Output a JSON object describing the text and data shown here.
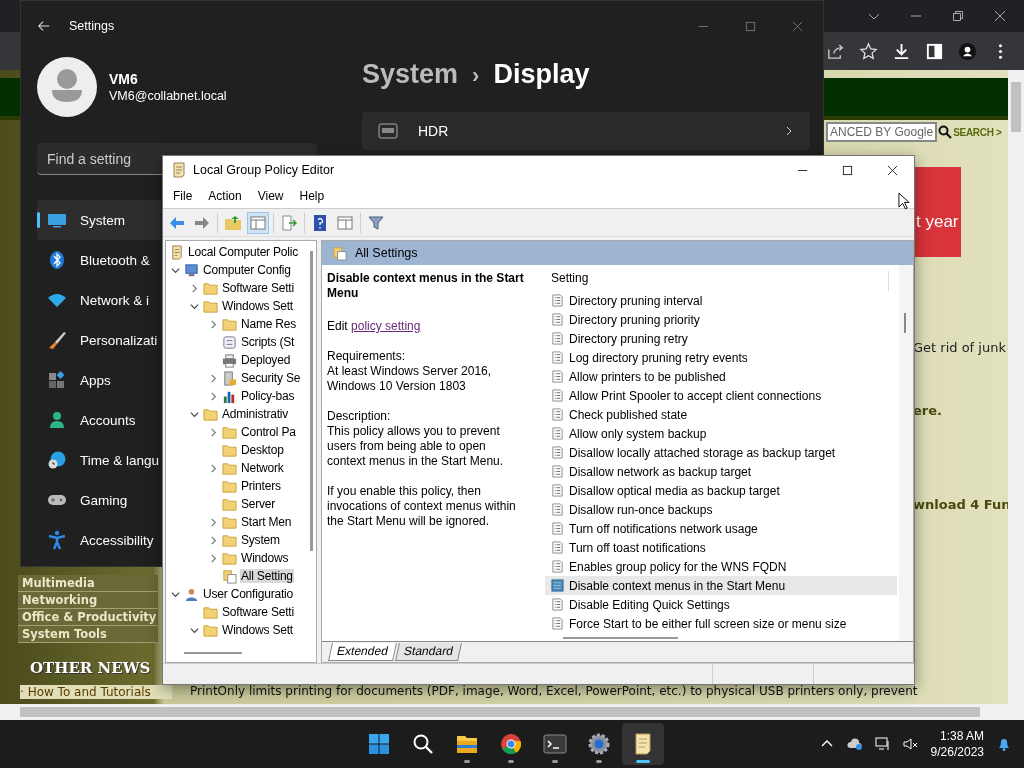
{
  "browser": {
    "search_box": "ANCED BY Google",
    "search_button": "SEARCH >",
    "ad_text": "t year",
    "snippets": [
      {
        "text": "Get rid of junk",
        "bold": false
      },
      {
        "text": "ere.",
        "bold": true
      },
      {
        "text": "wnload 4 Fun",
        "bold": true
      }
    ],
    "menu": [
      "Multimedia",
      "Networking",
      "Office & Productivity",
      "System Tools"
    ],
    "news_heading": "OTHER NEWS",
    "news_link": "· How To and Tutorials",
    "ticker": "PrintOnly limits printing for documents (PDF, image, Word, Excel, PowerPoint, etc.) to physical USB printers only, prevent"
  },
  "settings": {
    "title": "Settings",
    "user_name": "VM6",
    "user_email": "VM6@collabnet.local",
    "search": {
      "placeholder": "Find a setting"
    },
    "nav": [
      {
        "kind": "system",
        "label": "System",
        "selected": true
      },
      {
        "kind": "bluetooth",
        "label": "Bluetooth &",
        "selected": false
      },
      {
        "kind": "network",
        "label": "Network & i",
        "selected": false
      },
      {
        "kind": "personalization",
        "label": "Personalizati",
        "selected": false
      },
      {
        "kind": "apps",
        "label": "Apps",
        "selected": false
      },
      {
        "kind": "accounts",
        "label": "Accounts",
        "selected": false
      },
      {
        "kind": "time",
        "label": "Time & langu",
        "selected": false
      },
      {
        "kind": "gaming",
        "label": "Gaming",
        "selected": false
      },
      {
        "kind": "accessibility",
        "label": "Accessibility",
        "selected": false
      }
    ],
    "breadcrumb": [
      "System",
      "Display"
    ],
    "breadcrumb_separator": "›",
    "cards": [
      {
        "kind": "hdr",
        "label": "HDR"
      }
    ]
  },
  "gpo": {
    "title": "Local Group Policy Editor",
    "menu": [
      "File",
      "Action",
      "View",
      "Help"
    ],
    "tree": [
      {
        "kind": "scroll",
        "label": "Local Computer Polic",
        "selected": false,
        "children": [
          {
            "kind": "computer",
            "label": "Computer Config",
            "expanded": true,
            "selected": false,
            "children": [
              {
                "kind": "folder",
                "label": "Software Setti",
                "expanded": false,
                "selected": false
              },
              {
                "kind": "folder",
                "label": "Windows Sett",
                "expanded": true,
                "selected": false,
                "children": [
                  {
                    "kind": "folder",
                    "label": "Name Res",
                    "expanded": false,
                    "selected": false
                  },
                  {
                    "kind": "scripts",
                    "label": "Scripts (St",
                    "selected": false
                  },
                  {
                    "kind": "printer",
                    "label": "Deployed",
                    "selected": false
                  },
                  {
                    "kind": "security",
                    "label": "Security Se",
                    "expanded": false,
                    "selected": false
                  },
                  {
                    "kind": "chart",
                    "label": "Policy-bas",
                    "expanded": false,
                    "selected": false
                  }
                ]
              },
              {
                "kind": "folder",
                "label": "Administrativ",
                "expanded": true,
                "selected": false,
                "children": [
                  {
                    "kind": "folder",
                    "label": "Control Pa",
                    "expanded": false,
                    "selected": false
                  },
                  {
                    "kind": "folder",
                    "label": "Desktop",
                    "selected": false
                  },
                  {
                    "kind": "folder",
                    "label": "Network",
                    "expanded": false,
                    "selected": false
                  },
                  {
                    "kind": "folder",
                    "label": "Printers",
                    "selected": false
                  },
                  {
                    "kind": "folder",
                    "label": "Server",
                    "selected": false
                  },
                  {
                    "kind": "folder",
                    "label": "Start Men",
                    "expanded": false,
                    "selected": false
                  },
                  {
                    "kind": "folder",
                    "label": "System",
                    "expanded": false,
                    "selected": false
                  },
                  {
                    "kind": "folder",
                    "label": "Windows",
                    "expanded": false,
                    "selected": false
                  },
                  {
                    "kind": "allsettings",
                    "label": "All Setting",
                    "selected": true
                  }
                ]
              }
            ]
          },
          {
            "kind": "user",
            "label": "User Configuratio",
            "expanded": true,
            "selected": false,
            "children": [
              {
                "kind": "folder",
                "label": "Software Setti",
                "selected": false
              },
              {
                "kind": "folder",
                "label": "Windows Sett",
                "expanded": true,
                "selected": false
              }
            ]
          }
        ]
      }
    ],
    "header": "All Settings",
    "detail": {
      "title": "Disable context menus in the Start Menu",
      "edit_prefix": "Edit",
      "edit_link": "policy setting",
      "requirements_label": "Requirements:",
      "requirements": "At least Windows Server 2016, Windows 10 Version 1803",
      "description_label": "Description:",
      "paragraphs": [
        "This policy allows you to prevent users from being able to open context menus in the Start Menu.",
        "If you enable this policy, then invocations of context menus within the Start Menu will be ignored."
      ]
    },
    "column": "Setting",
    "policies": [
      {
        "label": "Directory pruning interval",
        "selected": false
      },
      {
        "label": "Directory pruning priority",
        "selected": false
      },
      {
        "label": "Directory pruning retry",
        "selected": false
      },
      {
        "label": "Log directory pruning retry events",
        "selected": false
      },
      {
        "label": "Allow printers to be published",
        "selected": false
      },
      {
        "label": "Allow Print Spooler to accept client connections",
        "selected": false
      },
      {
        "label": "Check published state",
        "selected": false
      },
      {
        "label": "Allow only system backup",
        "selected": false
      },
      {
        "label": "Disallow locally attached storage as backup target",
        "selected": false
      },
      {
        "label": "Disallow network as backup target",
        "selected": false
      },
      {
        "label": "Disallow optical media as backup target",
        "selected": false
      },
      {
        "label": "Disallow run-once backups",
        "selected": false
      },
      {
        "label": "Turn off notifications network usage",
        "selected": false
      },
      {
        "label": "Turn off toast notifications",
        "selected": false
      },
      {
        "label": "Enables group policy for the WNS FQDN",
        "selected": false
      },
      {
        "label": "Disable context menus in the Start Menu",
        "selected": true
      },
      {
        "label": "Disable Editing Quick Settings",
        "selected": false
      },
      {
        "label": "Force Start to be either full screen size or menu size",
        "selected": false
      }
    ],
    "tabs": [
      {
        "label": "Extended",
        "selected": true
      },
      {
        "label": "Standard",
        "selected": false
      }
    ]
  },
  "taskbar": {
    "apps": [
      {
        "kind": "start",
        "running": false,
        "selected": false
      },
      {
        "kind": "search",
        "running": false,
        "selected": false
      },
      {
        "kind": "explorer",
        "running": true,
        "selected": false
      },
      {
        "kind": "chrome",
        "running": true,
        "selected": false
      },
      {
        "kind": "terminal",
        "running": true,
        "selected": false
      },
      {
        "kind": "settings",
        "running": true,
        "selected": false
      },
      {
        "kind": "gpedit",
        "running": true,
        "selected": true
      }
    ],
    "time": "1:38 AM",
    "date": "9/26/2023"
  }
}
